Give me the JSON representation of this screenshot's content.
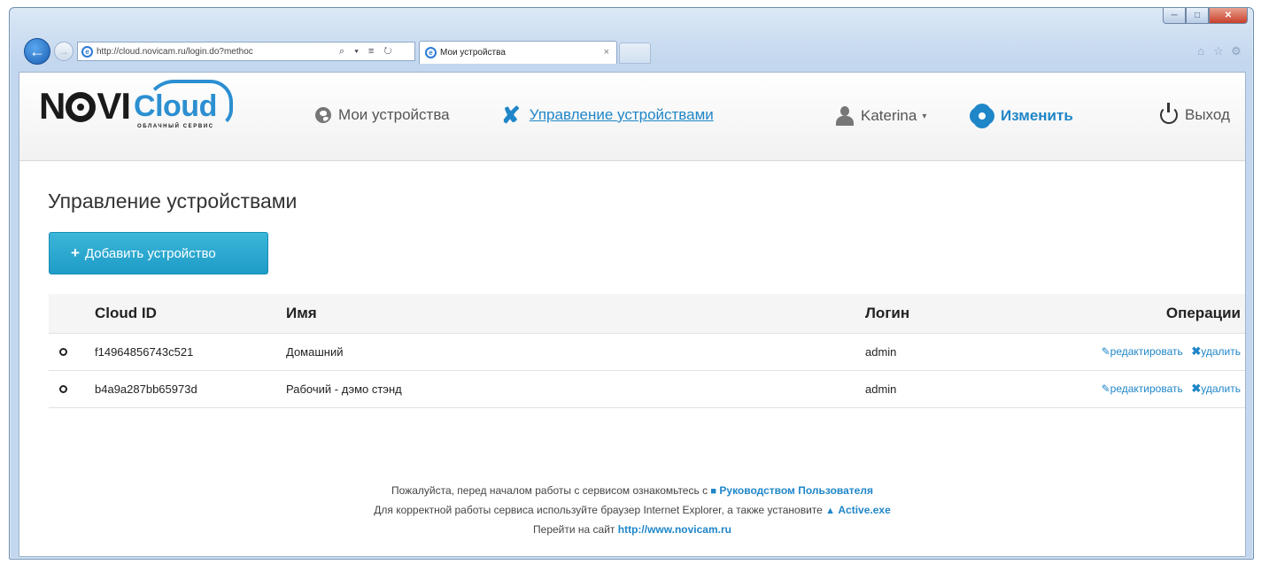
{
  "browser": {
    "address": "http://cloud.novicam.ru/login.do?methoc",
    "address_tools": "⌕ ▾ ≡ ↻",
    "tab_title": "Мои устройства",
    "tab_close": "×"
  },
  "header": {
    "logo_novi_1": "N",
    "logo_novi_2": "VI",
    "logo_cloud": "Cloud",
    "logo_sub": "ОБЛАЧНЫЙ СЕРВИС",
    "nav": {
      "my_devices": "Мои устройства",
      "manage_devices": "Управление устройствами",
      "user": "Katerina",
      "change": "Изменить",
      "exit": "Выход"
    }
  },
  "main": {
    "title": "Управление устройствами",
    "add_button": "Добавить устройство",
    "table": {
      "headers": {
        "cloud_id": "Cloud ID",
        "name": "Имя",
        "login": "Логин",
        "operations": "Операции"
      },
      "rows": [
        {
          "cloud_id": "f14964856743c521",
          "name": "Домашний",
          "login": "admin",
          "edit": "редактировать",
          "delete": "удалить"
        },
        {
          "cloud_id": "b4a9a287bb65973d",
          "name": "Рабочий - дэмо стэнд",
          "login": "admin",
          "edit": "редактировать",
          "delete": "удалить"
        }
      ]
    }
  },
  "footer": {
    "line1_text": "Пожалуйста, перед началом работы с сервисом ознакомьтесь с",
    "line1_link": "Руководством Пользователя",
    "line2_text": "Для корректной работы сервиса используйте браузер Internet Explorer, а также установите",
    "line2_link": "Active.exe",
    "line3_text": "Перейти на сайт",
    "line3_link": "http://www.novicam.ru"
  },
  "colors": {
    "accent": "#1f86c8",
    "button": "#2aa8d0",
    "brand_cloud": "#2c8fd1"
  },
  "icons": {
    "back": "back-arrow-icon",
    "forward": "forward-arrow-icon",
    "my_devices": "globe-icon",
    "manage": "wrench-icon",
    "user": "user-icon",
    "change": "gear-icon",
    "exit": "power-icon",
    "row": "circle-icon",
    "edit": "pencil-icon",
    "delete": "x-icon",
    "manual": "document-icon",
    "download": "download-icon"
  }
}
